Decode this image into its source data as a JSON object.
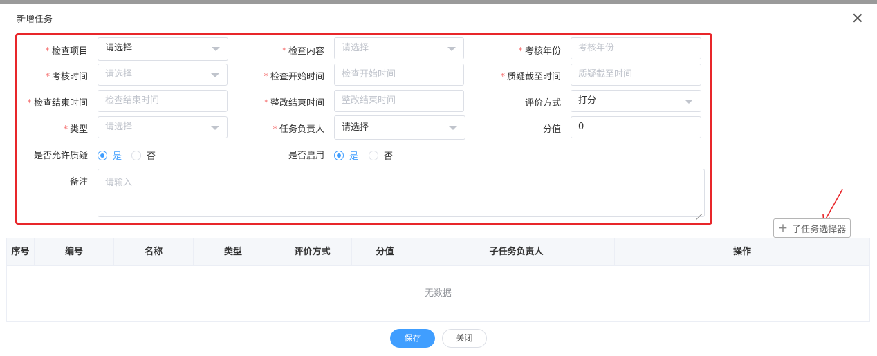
{
  "dialog": {
    "title": "新增任务"
  },
  "form": {
    "inspect_item": {
      "label": "检查项目",
      "placeholder": "请选择"
    },
    "inspect_content": {
      "label": "检查内容",
      "placeholder": "请选择"
    },
    "assess_year": {
      "label": "考核年份",
      "placeholder": "考核年份"
    },
    "assess_time": {
      "label": "考核时间",
      "placeholder": "请选择"
    },
    "inspect_start": {
      "label": "检查开始时间",
      "placeholder": "检查开始时间"
    },
    "query_deadline": {
      "label": "质疑截至时间",
      "placeholder": "质疑截至时间"
    },
    "inspect_end": {
      "label": "检查结束时间",
      "placeholder": "检查结束时间"
    },
    "rectify_end": {
      "label": "整改结束时间",
      "placeholder": "整改结束时间"
    },
    "eval_method": {
      "label": "评价方式",
      "value": "打分"
    },
    "type": {
      "label": "类型",
      "placeholder": "请选择"
    },
    "task_owner": {
      "label": "任务负责人",
      "placeholder": "请选择"
    },
    "score": {
      "label": "分值",
      "value": "0"
    },
    "allow_query": {
      "label": "是否允许质疑",
      "yes": "是",
      "no": "否",
      "selected": "是"
    },
    "enabled": {
      "label": "是否启用",
      "yes": "是",
      "no": "否",
      "selected": "是"
    },
    "remark": {
      "label": "备注",
      "placeholder": "请输入"
    }
  },
  "subtask_button": {
    "label": "子任务选择器"
  },
  "table": {
    "headers": [
      "序号",
      "编号",
      "名称",
      "类型",
      "评价方式",
      "分值",
      "子任务负责人",
      "操作"
    ],
    "empty_text": "无数据"
  },
  "footer": {
    "save": "保存",
    "close": "关闭"
  },
  "colors": {
    "primary": "#409eff",
    "annotation": "#e8262a",
    "required": "#f56c6c"
  }
}
